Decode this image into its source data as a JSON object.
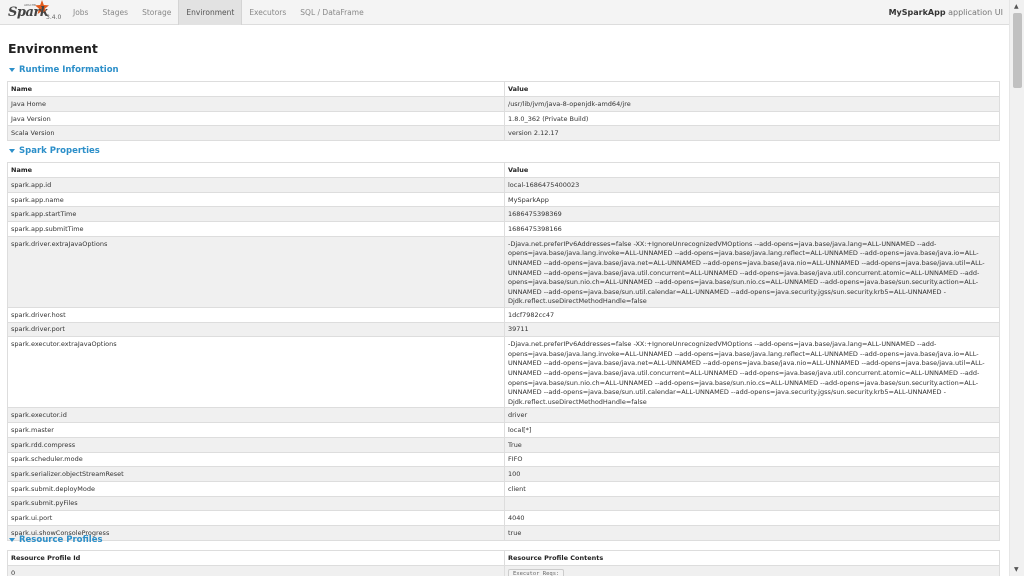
{
  "brand": {
    "apache": "APACHE",
    "name": "Spark",
    "version": "3.4.0"
  },
  "tabs": [
    "Jobs",
    "Stages",
    "Storage",
    "Environment",
    "Executors",
    "SQL / DataFrame"
  ],
  "active_tab": "Environment",
  "app": {
    "name": "MySparkApp",
    "suffix": "application UI"
  },
  "page_title": "Environment",
  "runtime": {
    "title": "Runtime Information",
    "headers": [
      "Name",
      "Value"
    ],
    "rows": [
      [
        "Java Home",
        "/usr/lib/jvm/java-8-openjdk-amd64/jre"
      ],
      [
        "Java Version",
        "1.8.0_362 (Private Build)"
      ],
      [
        "Scala Version",
        "version 2.12.17"
      ]
    ]
  },
  "spark_props": {
    "title": "Spark Properties",
    "headers": [
      "Name",
      "Value"
    ],
    "rows": [
      [
        "spark.app.id",
        "local-1686475400023"
      ],
      [
        "spark.app.name",
        "MySparkApp"
      ],
      [
        "spark.app.startTime",
        "1686475398369"
      ],
      [
        "spark.app.submitTime",
        "1686475398166"
      ],
      [
        "spark.driver.extraJavaOptions",
        "-Djava.net.preferIPv6Addresses=false -XX:+IgnoreUnrecognizedVMOptions --add-opens=java.base/java.lang=ALL-UNNAMED --add-opens=java.base/java.lang.invoke=ALL-UNNAMED --add-opens=java.base/java.lang.reflect=ALL-UNNAMED --add-opens=java.base/java.io=ALL-UNNAMED --add-opens=java.base/java.net=ALL-UNNAMED --add-opens=java.base/java.nio=ALL-UNNAMED --add-opens=java.base/java.util=ALL-UNNAMED --add-opens=java.base/java.util.concurrent=ALL-UNNAMED --add-opens=java.base/java.util.concurrent.atomic=ALL-UNNAMED --add-opens=java.base/sun.nio.ch=ALL-UNNAMED --add-opens=java.base/sun.nio.cs=ALL-UNNAMED --add-opens=java.base/sun.security.action=ALL-UNNAMED --add-opens=java.base/sun.util.calendar=ALL-UNNAMED --add-opens=java.security.jgss/sun.security.krb5=ALL-UNNAMED -Djdk.reflect.useDirectMethodHandle=false"
      ],
      [
        "spark.driver.host",
        "1dcf7982cc47"
      ],
      [
        "spark.driver.port",
        "39711"
      ],
      [
        "spark.executor.extraJavaOptions",
        "-Djava.net.preferIPv6Addresses=false -XX:+IgnoreUnrecognizedVMOptions --add-opens=java.base/java.lang=ALL-UNNAMED --add-opens=java.base/java.lang.invoke=ALL-UNNAMED --add-opens=java.base/java.lang.reflect=ALL-UNNAMED --add-opens=java.base/java.io=ALL-UNNAMED --add-opens=java.base/java.net=ALL-UNNAMED --add-opens=java.base/java.nio=ALL-UNNAMED --add-opens=java.base/java.util=ALL-UNNAMED --add-opens=java.base/java.util.concurrent=ALL-UNNAMED --add-opens=java.base/java.util.concurrent.atomic=ALL-UNNAMED --add-opens=java.base/sun.nio.ch=ALL-UNNAMED --add-opens=java.base/sun.nio.cs=ALL-UNNAMED --add-opens=java.base/sun.security.action=ALL-UNNAMED --add-opens=java.base/sun.util.calendar=ALL-UNNAMED --add-opens=java.security.jgss/sun.security.krb5=ALL-UNNAMED -Djdk.reflect.useDirectMethodHandle=false"
      ],
      [
        "spark.executor.id",
        "driver"
      ],
      [
        "spark.master",
        "local[*]"
      ],
      [
        "spark.rdd.compress",
        "True"
      ],
      [
        "spark.scheduler.mode",
        "FIFO"
      ],
      [
        "spark.serializer.objectStreamReset",
        "100"
      ],
      [
        "spark.submit.deployMode",
        "client"
      ],
      [
        "spark.submit.pyFiles",
        ""
      ],
      [
        "spark.ui.port",
        "4040"
      ],
      [
        "spark.ui.showConsoleProgress",
        "true"
      ]
    ]
  },
  "resource_profiles": {
    "title": "Resource Profiles",
    "headers": [
      "Resource Profile Id",
      "Resource Profile Contents"
    ],
    "rows": [
      [
        "0",
        "Executor Reqs:"
      ]
    ]
  },
  "colors": {
    "accent": "#2c8fc9",
    "stripe": "#f0f0f0",
    "navbar": "#f4f4f4"
  }
}
